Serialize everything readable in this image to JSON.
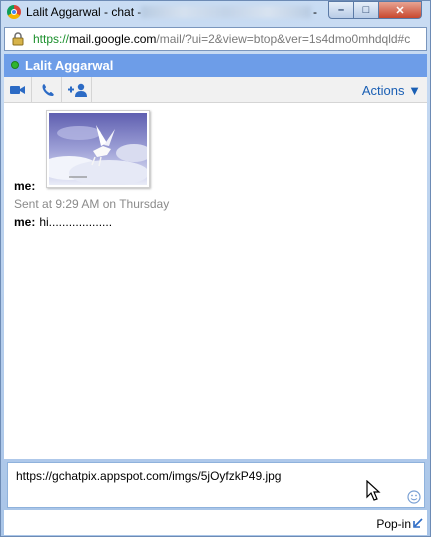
{
  "window": {
    "title_prefix": "Lalit Aggarwal - chat -",
    "title_tail": "-",
    "buttons": {
      "minimize": "–",
      "maximize": "□",
      "close": "✕"
    }
  },
  "address": {
    "scheme": "https://",
    "host": "mail.google.com",
    "path": "/mail/?ui=2&view=btop&ver=1s4dmo0mhdqld#c"
  },
  "chat": {
    "contact_name": "Lalit Aggarwal",
    "status_color": "#2fb52f",
    "toolbar": {
      "video_icon": "video-camera-icon",
      "call_icon": "phone-icon",
      "add_icon": "add-person-icon",
      "actions_label": "Actions ▼"
    },
    "messages": [
      {
        "sender": "me:",
        "text": ""
      },
      {
        "sender": "me:",
        "text": "hi..................."
      }
    ],
    "sent_info": "Sent at 9:29 AM on Thursday"
  },
  "input": {
    "value": "https://gchatpix.appspot.com/imgs/5jOyfzkP49.jpg"
  },
  "footer": {
    "popin_label": "Pop-in"
  },
  "colors": {
    "header": "#6d9de8",
    "link": "#1a5fb4"
  }
}
